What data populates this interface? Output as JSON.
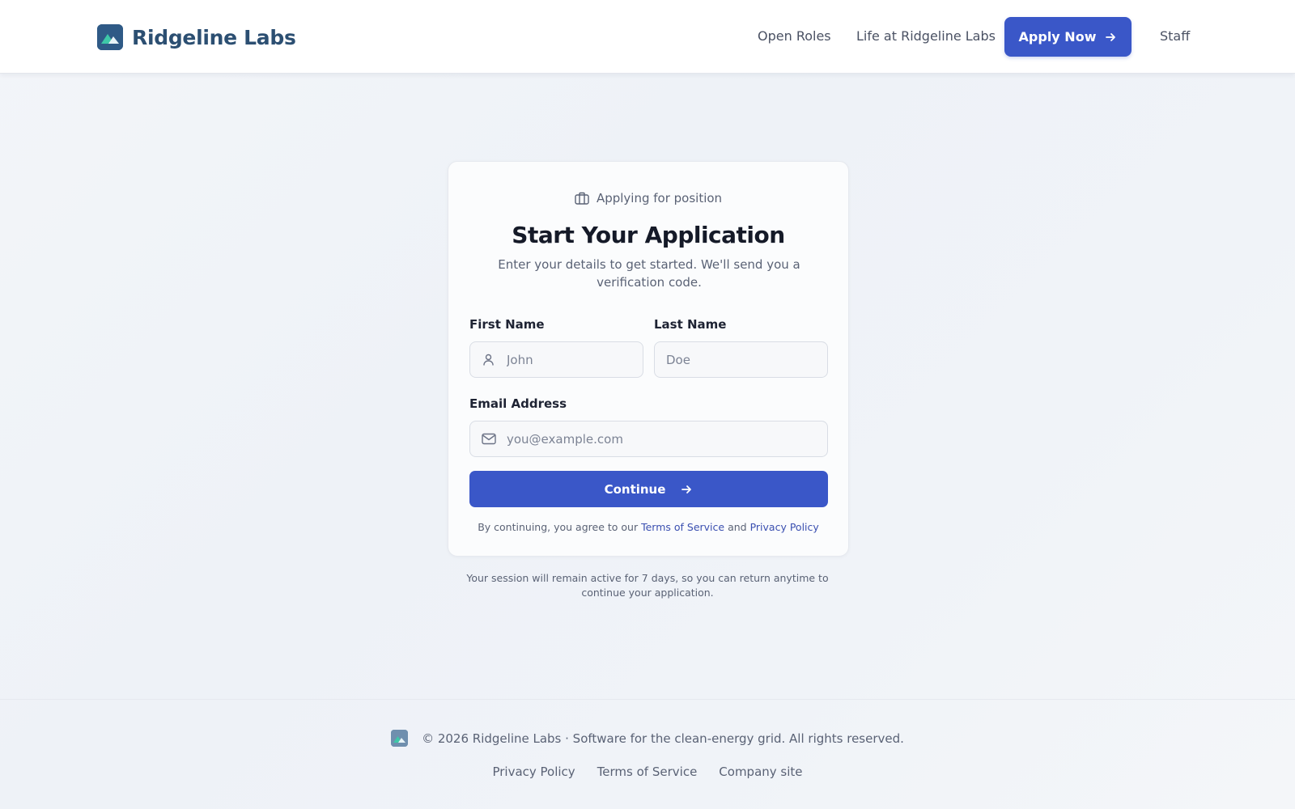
{
  "header": {
    "brand_name": "Ridgeline Labs",
    "nav": {
      "open_roles": "Open Roles",
      "life": "Life at Ridgeline Labs",
      "apply_now": "Apply Now",
      "staff": "Staff"
    }
  },
  "card": {
    "position_label": "Applying for position",
    "title": "Start Your Application",
    "subtitle": "Enter your details to get started. We'll send you a verification code.",
    "first_name": {
      "label": "First Name",
      "placeholder": "John",
      "value": ""
    },
    "last_name": {
      "label": "Last Name",
      "placeholder": "Doe",
      "value": ""
    },
    "email": {
      "label": "Email Address",
      "placeholder": "you@example.com",
      "value": ""
    },
    "continue_label": "Continue",
    "terms_prefix": "By continuing, you agree to our",
    "terms_link": "Terms of Service",
    "terms_and": "and",
    "privacy_link": "Privacy Policy"
  },
  "session_note": "Your session will remain active for 7 days, so you can return anytime to continue your application.",
  "footer": {
    "copyright": "© 2026 Ridgeline Labs · Software for the clean-energy grid. All rights reserved.",
    "links": {
      "privacy": "Privacy Policy",
      "terms": "Terms of Service",
      "company": "Company site"
    }
  },
  "colors": {
    "accent": "#3a57c8",
    "brand": "#2c4f72",
    "logo_mountain": "#3ec7a8"
  },
  "icons": {
    "brand_logo": "mountain-logo-icon",
    "apply_arrow": "arrow-right-icon",
    "position": "briefcase-icon",
    "first_name": "user-icon",
    "email": "mail-icon",
    "continue_arrow": "arrow-right-icon"
  }
}
